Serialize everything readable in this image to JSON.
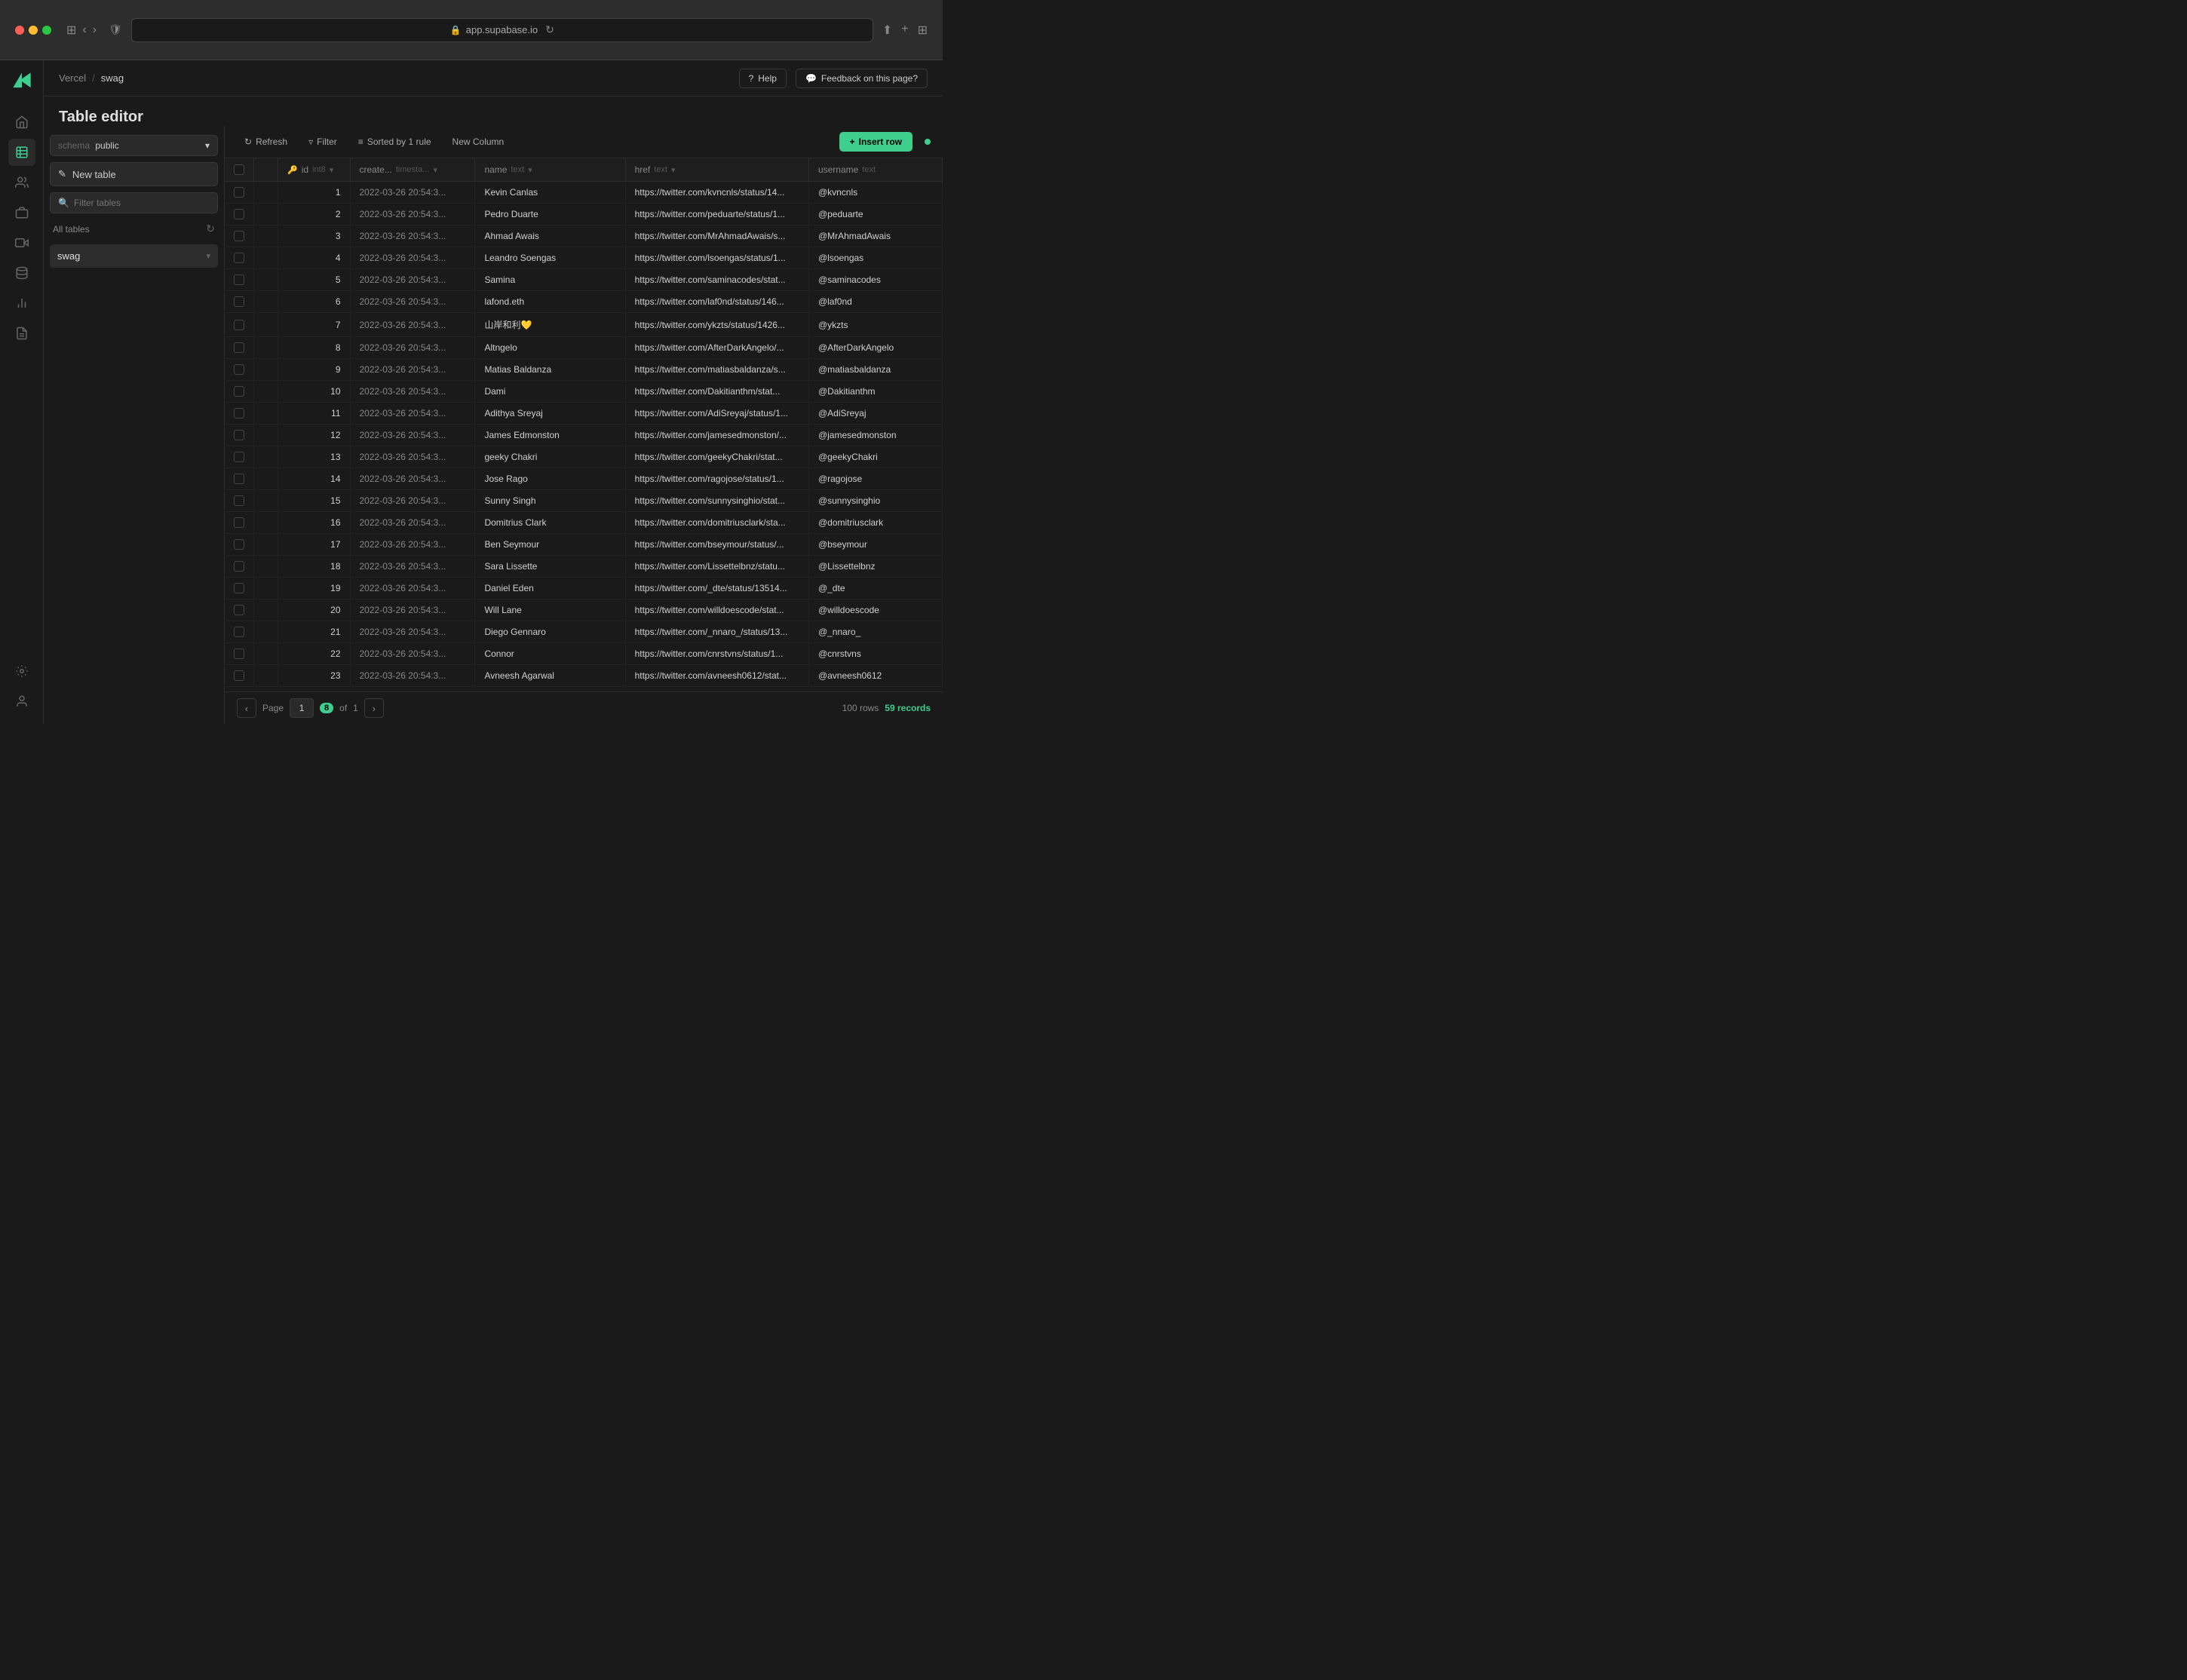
{
  "browser": {
    "url": "app.supabase.io"
  },
  "breadcrumb": {
    "project": "Vercel",
    "separator": "/",
    "section": "swag"
  },
  "page": {
    "title": "Table editor"
  },
  "topbar": {
    "help_label": "Help",
    "feedback_label": "Feedback on this page?"
  },
  "sidebar": {
    "icons": [
      "home",
      "table",
      "users",
      "box",
      "film",
      "database",
      "chart",
      "document",
      "settings"
    ]
  },
  "left_panel": {
    "schema_label": "schema",
    "schema_value": "public",
    "new_table_label": "New table",
    "filter_placeholder": "Filter tables",
    "all_tables_label": "All tables",
    "tables": [
      {
        "name": "swag"
      }
    ]
  },
  "toolbar": {
    "refresh_label": "Refresh",
    "filter_label": "Filter",
    "sort_label": "Sorted by 1 rule",
    "new_column_label": "New Column",
    "insert_row_label": "Insert row"
  },
  "table": {
    "columns": [
      {
        "name": "id",
        "type": "int8"
      },
      {
        "name": "created_at",
        "type": "timestamp"
      },
      {
        "name": "name",
        "type": "text"
      },
      {
        "name": "href",
        "type": "text"
      },
      {
        "name": "username",
        "type": "text"
      }
    ],
    "rows": [
      {
        "id": 1,
        "created_at": "2022-03-26 20:54:3...",
        "name": "Kevin Canlas",
        "href": "https://twitter.com/kvncnls/status/14...",
        "username": "@kvncnls"
      },
      {
        "id": 2,
        "created_at": "2022-03-26 20:54:3...",
        "name": "Pedro Duarte",
        "href": "https://twitter.com/peduarte/status/1...",
        "username": "@peduarte"
      },
      {
        "id": 3,
        "created_at": "2022-03-26 20:54:3...",
        "name": "Ahmad Awais",
        "href": "https://twitter.com/MrAhmadAwais/s...",
        "username": "@MrAhmadAwais"
      },
      {
        "id": 4,
        "created_at": "2022-03-26 20:54:3...",
        "name": "Leandro Soengas",
        "href": "https://twitter.com/lsoengas/status/1...",
        "username": "@lsoengas"
      },
      {
        "id": 5,
        "created_at": "2022-03-26 20:54:3...",
        "name": "Samina",
        "href": "https://twitter.com/saminacodes/stat...",
        "username": "@saminacodes"
      },
      {
        "id": 6,
        "created_at": "2022-03-26 20:54:3...",
        "name": "lafond.eth",
        "href": "https://twitter.com/laf0nd/status/146...",
        "username": "@laf0nd"
      },
      {
        "id": 7,
        "created_at": "2022-03-26 20:54:3...",
        "name": "山岸和利💛",
        "href": "https://twitter.com/ykzts/status/1426...",
        "username": "@ykzts"
      },
      {
        "id": 8,
        "created_at": "2022-03-26 20:54:3...",
        "name": "Altngelo",
        "href": "https://twitter.com/AfterDarkAngelo/...",
        "username": "@AfterDarkAngelo"
      },
      {
        "id": 9,
        "created_at": "2022-03-26 20:54:3...",
        "name": "Matias Baldanza",
        "href": "https://twitter.com/matiasbaldanza/s...",
        "username": "@matiasbaldanza"
      },
      {
        "id": 10,
        "created_at": "2022-03-26 20:54:3...",
        "name": "Dami",
        "href": "https://twitter.com/Dakitianthm/stat...",
        "username": "@Dakitianthm"
      },
      {
        "id": 11,
        "created_at": "2022-03-26 20:54:3...",
        "name": "Adithya Sreyaj",
        "href": "https://twitter.com/AdiSreyaj/status/1...",
        "username": "@AdiSreyaj"
      },
      {
        "id": 12,
        "created_at": "2022-03-26 20:54:3...",
        "name": "James Edmonston",
        "href": "https://twitter.com/jamesedmonston/...",
        "username": "@jamesedmonston"
      },
      {
        "id": 13,
        "created_at": "2022-03-26 20:54:3...",
        "name": "geeky Chakri",
        "href": "https://twitter.com/geekyChakri/stat...",
        "username": "@geekyChakri"
      },
      {
        "id": 14,
        "created_at": "2022-03-26 20:54:3...",
        "name": "Jose Rago",
        "href": "https://twitter.com/ragojose/status/1...",
        "username": "@ragojose"
      },
      {
        "id": 15,
        "created_at": "2022-03-26 20:54:3...",
        "name": "Sunny Singh",
        "href": "https://twitter.com/sunnysinghio/stat...",
        "username": "@sunnysinghio"
      },
      {
        "id": 16,
        "created_at": "2022-03-26 20:54:3...",
        "name": "Domitrius Clark",
        "href": "https://twitter.com/domitriusclark/sta...",
        "username": "@domitriusclark"
      },
      {
        "id": 17,
        "created_at": "2022-03-26 20:54:3...",
        "name": "Ben Seymour",
        "href": "https://twitter.com/bseymour/status/...",
        "username": "@bseymour"
      },
      {
        "id": 18,
        "created_at": "2022-03-26 20:54:3...",
        "name": "Sara Lissette",
        "href": "https://twitter.com/Lissettelbnz/statu...",
        "username": "@Lissettelbnz"
      },
      {
        "id": 19,
        "created_at": "2022-03-26 20:54:3...",
        "name": "Daniel Eden",
        "href": "https://twitter.com/_dte/status/13514...",
        "username": "@_dte"
      },
      {
        "id": 20,
        "created_at": "2022-03-26 20:54:3...",
        "name": "Will Lane",
        "href": "https://twitter.com/willdoescode/stat...",
        "username": "@willdoescode"
      },
      {
        "id": 21,
        "created_at": "2022-03-26 20:54:3...",
        "name": "Diego Gennaro",
        "href": "https://twitter.com/_nnaro_/status/13...",
        "username": "@_nnaro_"
      },
      {
        "id": 22,
        "created_at": "2022-03-26 20:54:3...",
        "name": "Connor",
        "href": "https://twitter.com/cnrstvns/status/1...",
        "username": "@cnrstvns"
      },
      {
        "id": 23,
        "created_at": "2022-03-26 20:54:3...",
        "name": "Avneesh Agarwal",
        "href": "https://twitter.com/avneesh0612/stat...",
        "username": "@avneesh0612"
      }
    ]
  },
  "pagination": {
    "page_label": "Page",
    "page_current": "1",
    "page_total": "1",
    "of_label": "of",
    "rows_label": "100 rows",
    "records_label": "59 records"
  }
}
